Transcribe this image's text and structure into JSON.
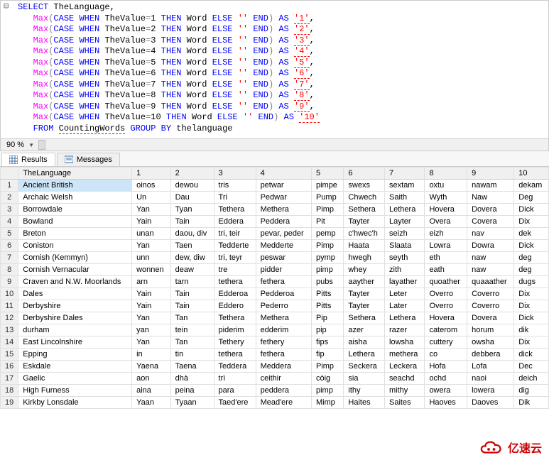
{
  "zoom": "90 %",
  "tabs": {
    "results": "Results",
    "messages": "Messages"
  },
  "sql": {
    "select": "SELECT",
    "col0": "TheLanguage",
    "max": "Max",
    "lp": "(",
    "case": "CASE",
    "when": "WHEN",
    "field": "TheValue",
    "eq": "=",
    "then": "THEN",
    "wordcol": "Word",
    "else": "ELSE",
    "empty": "''",
    "end": "END",
    "rp": ")",
    "as": "AS",
    "from": "FROM",
    "table": "CountingWords",
    "groupby": "GROUP BY",
    "groupcol": "thelanguage",
    "comma": ",",
    "aliases": [
      "'1'",
      "'2'",
      "'3'",
      "'4'",
      "'5'",
      "'6'",
      "'7'",
      "'8'",
      "'9'",
      "'10'"
    ],
    "values": [
      "1",
      "2",
      "3",
      "4",
      "5",
      "6",
      "7",
      "8",
      "9",
      "10"
    ]
  },
  "columns": [
    "TheLanguage",
    "1",
    "2",
    "3",
    "4",
    "5",
    "6",
    "7",
    "8",
    "9",
    "10"
  ],
  "rows": [
    {
      "n": "1",
      "c": [
        "Ancient British",
        "oinos",
        "dewou",
        "tris",
        "petwar",
        "pimpe",
        "swexs",
        "sextam",
        "oxtu",
        "nawam",
        "dekam"
      ]
    },
    {
      "n": "2",
      "c": [
        "Archaic Welsh",
        "Un",
        "Dau",
        "Tri",
        "Pedwar",
        "Pump",
        "Chwech",
        "Saith",
        "Wyth",
        "Naw",
        "Deg"
      ]
    },
    {
      "n": "3",
      "c": [
        "Borrowdale",
        "Yan",
        "Tyan",
        "Tethera",
        "Methera",
        "Pimp",
        "Sethera",
        "Lethera",
        "Hovera",
        "Dovera",
        "Dick"
      ]
    },
    {
      "n": "4",
      "c": [
        "Bowland",
        "Yain",
        "Tain",
        "Eddera",
        "Peddera",
        "Pit",
        "Tayter",
        "Layter",
        "Overa",
        "Covera",
        "Dix"
      ]
    },
    {
      "n": "5",
      "c": [
        "Breton",
        "unan",
        "daou, div",
        "tri, teir",
        "pevar, peder",
        "pemp",
        "c'hwec'h",
        "seizh",
        "eizh",
        "nav",
        "dek"
      ]
    },
    {
      "n": "6",
      "c": [
        "Coniston",
        "Yan",
        "Taen",
        "Tedderte",
        "Medderte",
        "Pimp",
        "Haata",
        "Slaata",
        "Lowra",
        "Dowra",
        "Dick"
      ]
    },
    {
      "n": "7",
      "c": [
        "Cornish (Kemmyn)",
        "unn",
        "dew, diw",
        "tri, teyr",
        "peswar",
        "pymp",
        "hwegh",
        "seyth",
        "eth",
        "naw",
        "deg"
      ]
    },
    {
      "n": "8",
      "c": [
        "Cornish Vernacular",
        "wonnen",
        "deaw",
        "tre",
        "pidder",
        "pimp",
        "whey",
        "zith",
        "eath",
        "naw",
        "deg"
      ]
    },
    {
      "n": "9",
      "c": [
        "Craven and N.W. Moorlands",
        "arn",
        "tarn",
        "tethera",
        "fethera",
        "pubs",
        "aayther",
        "layather",
        "quoather",
        "quaaather",
        "dugs"
      ]
    },
    {
      "n": "10",
      "c": [
        "Dales",
        "Yain",
        "Tain",
        "Edderoa",
        "Pedderoa",
        "Pitts",
        "Tayter",
        "Leter",
        "Overro",
        "Coverro",
        "Dix"
      ]
    },
    {
      "n": "11",
      "c": [
        "Derbyshire",
        "Yain",
        "Tain",
        "Eddero",
        "Pederro",
        "Pitts",
        "Tayter",
        "Later",
        "Overro",
        "Coverro",
        "Dix"
      ]
    },
    {
      "n": "12",
      "c": [
        "Derbyshire Dales",
        "Yan",
        "Tan",
        "Tethera",
        "Methera",
        "Pip",
        "Sethera",
        "Lethera",
        "Hovera",
        "Dovera",
        "Dick"
      ]
    },
    {
      "n": "13",
      "c": [
        "durham",
        "yan",
        "tein",
        "piderim",
        "edderim",
        "pip",
        "azer",
        "razer",
        "caterom",
        "horum",
        "dik"
      ]
    },
    {
      "n": "14",
      "c": [
        "East Lincolnshire",
        "Yan",
        "Tan",
        "Tethery",
        "fethery",
        "fips",
        "aisha",
        "lowsha",
        "cuttery",
        "owsha",
        "Dix"
      ]
    },
    {
      "n": "15",
      "c": [
        "Epping",
        "in",
        "tin",
        "tethera",
        "fethera",
        "fip",
        "Lethera",
        "methera",
        "co",
        "debbera",
        "dick"
      ]
    },
    {
      "n": "16",
      "c": [
        "Eskdale",
        "Yaena",
        "Taena",
        "Teddera",
        "Meddera",
        "Pimp",
        "Seckera",
        "Leckera",
        "Hofa",
        "Lofa",
        "Dec"
      ]
    },
    {
      "n": "17",
      "c": [
        "Gaelic",
        "aon",
        "dhà",
        "trì",
        "ceithir",
        "còig",
        "sia",
        "seachd",
        "ochd",
        "naoi",
        "deich"
      ]
    },
    {
      "n": "18",
      "c": [
        "High Furness",
        "aina",
        "peina",
        "para",
        "peddera",
        "pimp",
        "ithy",
        "mithy",
        "owera",
        "lowera",
        "dig"
      ]
    },
    {
      "n": "19",
      "c": [
        "Kirkby Lonsdale",
        "Yaan",
        "Tyaan",
        "Taed'ere",
        "Mead'ere",
        "Mimp",
        "Haites",
        "Saites",
        "Haoves",
        "Daoves",
        "Dik"
      ]
    }
  ],
  "watermark_text": "亿速云"
}
